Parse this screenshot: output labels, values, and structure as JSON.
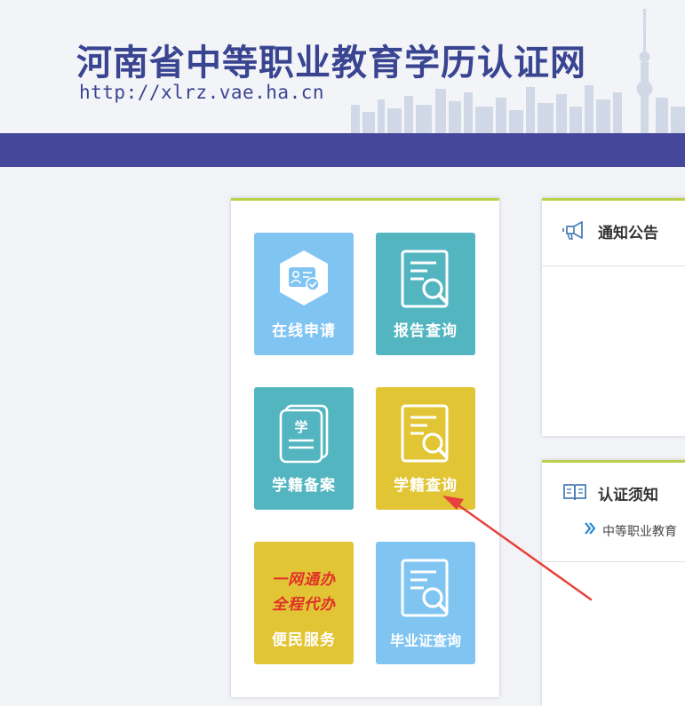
{
  "header": {
    "site_title": "河南省中等职业教育学历认证网",
    "site_url": "http://xlrz.vae.ha.cn"
  },
  "tiles": {
    "online_apply": {
      "label": "在线申请"
    },
    "report_query": {
      "label": "报告查询"
    },
    "enroll_record": {
      "label": "学籍备案",
      "icon_text": "学"
    },
    "enroll_query": {
      "label": "学籍查询"
    },
    "convenience": {
      "slogan_line1": "一网通办",
      "slogan_line2": "全程代办",
      "label": "便民服务"
    },
    "grad_cert_query": {
      "label": "毕业证查询"
    }
  },
  "cards": {
    "notice": {
      "title": "通知公告"
    },
    "cert_guide": {
      "title": "认证须知",
      "items": [
        "中等职业教育"
      ]
    }
  },
  "colors": {
    "nav": "#45479c",
    "title": "#3a4592",
    "tile_light_blue": "#80c5f2",
    "tile_teal": "#52b5c0",
    "tile_yellow": "#e2c534",
    "accent_border": "#b8d04a",
    "slogan_red": "#e0302a",
    "annotation_arrow": "#e8403a"
  }
}
